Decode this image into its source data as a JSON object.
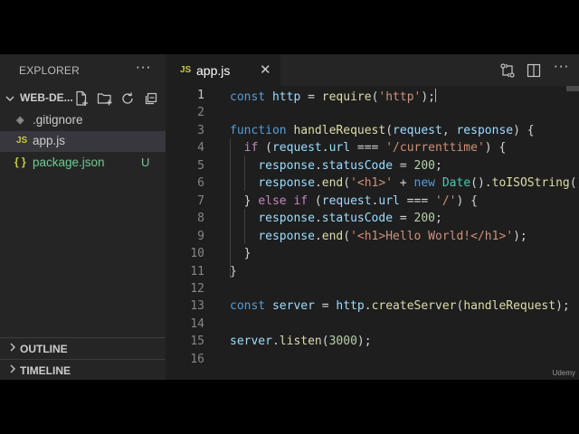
{
  "sidebar": {
    "title": "EXPLORER",
    "more": "···",
    "folder": {
      "name": "WEB-DE..."
    },
    "files": [
      {
        "icon": "◈",
        "name": ".gitignore",
        "badge": "",
        "color": "#cccccc",
        "icon_color": "#8c8c8c"
      },
      {
        "icon": "JS",
        "name": "app.js",
        "badge": "",
        "color": "#cccccc",
        "icon_color": "#cbcb41"
      },
      {
        "icon": "{ }",
        "name": "package.json",
        "badge": "U",
        "color": "#73c991",
        "icon_color": "#cbcb41"
      }
    ],
    "sections": [
      "OUTLINE",
      "TIMELINE"
    ]
  },
  "tab": {
    "icon": "JS",
    "label": "app.js",
    "close": "✕"
  },
  "editor": {
    "lines": [
      {
        "n": "1",
        "tokens": [
          [
            "kw",
            "const"
          ],
          [
            "p",
            " "
          ],
          [
            "var",
            "http"
          ],
          [
            "p",
            " = "
          ],
          [
            "fn",
            "require"
          ],
          [
            "p",
            "("
          ],
          [
            "str",
            "'http'"
          ],
          [
            "p",
            ");"
          ]
        ]
      },
      {
        "n": "2",
        "tokens": []
      },
      {
        "n": "3",
        "tokens": [
          [
            "kw",
            "function"
          ],
          [
            "p",
            " "
          ],
          [
            "fn",
            "handleRequest"
          ],
          [
            "p",
            "("
          ],
          [
            "var",
            "request"
          ],
          [
            "p",
            ", "
          ],
          [
            "var",
            "response"
          ],
          [
            "p",
            ") {"
          ]
        ]
      },
      {
        "n": "4",
        "tokens": [
          [
            "p",
            "  "
          ],
          [
            "ctl",
            "if"
          ],
          [
            "p",
            " ("
          ],
          [
            "var",
            "request"
          ],
          [
            "p",
            "."
          ],
          [
            "var",
            "url"
          ],
          [
            "p",
            " === "
          ],
          [
            "str",
            "'/currenttime'"
          ],
          [
            "p",
            ") {"
          ]
        ]
      },
      {
        "n": "5",
        "tokens": [
          [
            "p",
            "    "
          ],
          [
            "var",
            "response"
          ],
          [
            "p",
            "."
          ],
          [
            "var",
            "statusCode"
          ],
          [
            "p",
            " = "
          ],
          [
            "num",
            "200"
          ],
          [
            "p",
            ";"
          ]
        ]
      },
      {
        "n": "6",
        "tokens": [
          [
            "p",
            "    "
          ],
          [
            "var",
            "response"
          ],
          [
            "p",
            "."
          ],
          [
            "fn",
            "end"
          ],
          [
            "p",
            "("
          ],
          [
            "str",
            "'<h1>'"
          ],
          [
            "p",
            " + "
          ],
          [
            "kw",
            "new"
          ],
          [
            "p",
            " "
          ],
          [
            "cls",
            "Date"
          ],
          [
            "p",
            "()."
          ],
          [
            "fn",
            "toISOString"
          ],
          [
            "p",
            "()"
          ]
        ]
      },
      {
        "n": "7",
        "tokens": [
          [
            "p",
            "  } "
          ],
          [
            "ctl",
            "else if"
          ],
          [
            "p",
            " ("
          ],
          [
            "var",
            "request"
          ],
          [
            "p",
            "."
          ],
          [
            "var",
            "url"
          ],
          [
            "p",
            " === "
          ],
          [
            "str",
            "'/'"
          ],
          [
            "p",
            ") {"
          ]
        ]
      },
      {
        "n": "8",
        "tokens": [
          [
            "p",
            "    "
          ],
          [
            "var",
            "response"
          ],
          [
            "p",
            "."
          ],
          [
            "var",
            "statusCode"
          ],
          [
            "p",
            " = "
          ],
          [
            "num",
            "200"
          ],
          [
            "p",
            ";"
          ]
        ]
      },
      {
        "n": "9",
        "tokens": [
          [
            "p",
            "    "
          ],
          [
            "var",
            "response"
          ],
          [
            "p",
            "."
          ],
          [
            "fn",
            "end"
          ],
          [
            "p",
            "("
          ],
          [
            "str",
            "'<h1>Hello World!</h1>'"
          ],
          [
            "p",
            ");"
          ]
        ]
      },
      {
        "n": "10",
        "tokens": [
          [
            "p",
            "  }"
          ]
        ]
      },
      {
        "n": "11",
        "tokens": [
          [
            "p",
            "}"
          ]
        ]
      },
      {
        "n": "12",
        "tokens": []
      },
      {
        "n": "13",
        "tokens": [
          [
            "kw",
            "const"
          ],
          [
            "p",
            " "
          ],
          [
            "var",
            "server"
          ],
          [
            "p",
            " = "
          ],
          [
            "var",
            "http"
          ],
          [
            "p",
            "."
          ],
          [
            "fn",
            "createServer"
          ],
          [
            "p",
            "("
          ],
          [
            "fn",
            "handleRequest"
          ],
          [
            "p",
            ");"
          ]
        ]
      },
      {
        "n": "14",
        "tokens": []
      },
      {
        "n": "15",
        "tokens": [
          [
            "var",
            "server"
          ],
          [
            "p",
            "."
          ],
          [
            "fn",
            "listen"
          ],
          [
            "p",
            "("
          ],
          [
            "num",
            "3000"
          ],
          [
            "p",
            ");"
          ]
        ]
      },
      {
        "n": "16",
        "tokens": []
      }
    ],
    "current_line": "1"
  },
  "syntax_colors": {
    "kw": "#569cd6",
    "ctl": "#c586c0",
    "var": "#9cdcfe",
    "fn": "#dcdcaa",
    "str": "#ce9178",
    "num": "#b5cea8",
    "cls": "#4ec9b0",
    "p": "#d4d4d4"
  },
  "watermark": "Udemy"
}
